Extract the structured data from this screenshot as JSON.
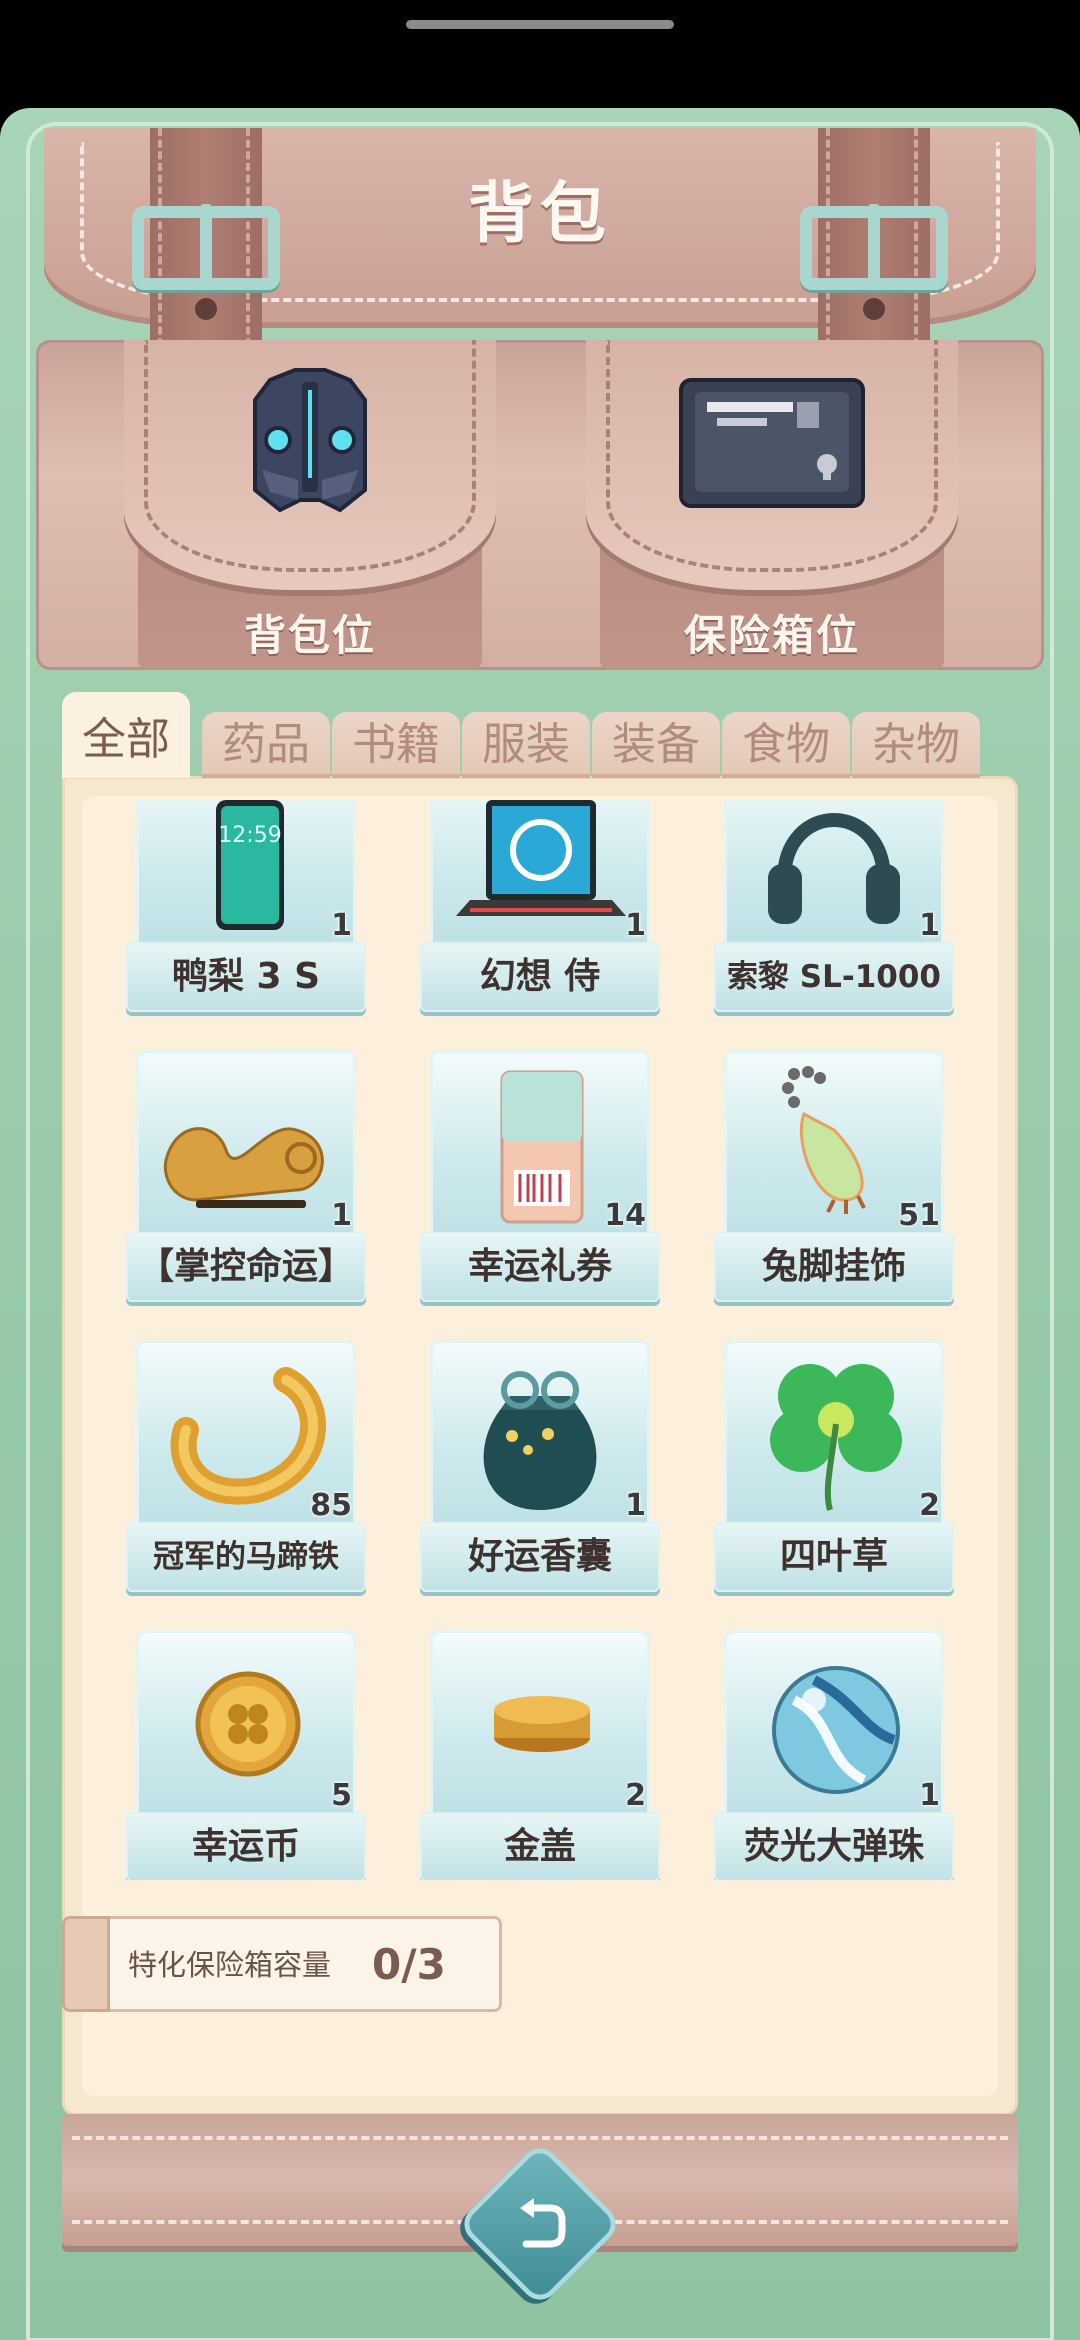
{
  "title": "背包",
  "pockets": [
    {
      "label": "背包位",
      "icon": "armor-vest-icon"
    },
    {
      "label": "保险箱位",
      "icon": "safe-box-icon"
    }
  ],
  "tabs": [
    "全部",
    "药品",
    "书籍",
    "服装",
    "装备",
    "食物",
    "杂物"
  ],
  "active_tab": "全部",
  "items": [
    {
      "name": "鸭梨 3 S",
      "count": "1",
      "icon": "smartphone-icon",
      "new": true
    },
    {
      "name": "幻想 侍",
      "count": "1",
      "icon": "laptop-icon",
      "new": true
    },
    {
      "name": "索黎 SL-1000",
      "count": "1",
      "icon": "headphones-icon",
      "new": true
    },
    {
      "name": "【掌控命运】",
      "count": "1",
      "icon": "ruyi-scepter-icon",
      "new": false
    },
    {
      "name": "幸运礼券",
      "count": "14",
      "icon": "coupon-ticket-icon",
      "new": false
    },
    {
      "name": "兔脚挂饰",
      "count": "51",
      "icon": "rabbit-foot-charm-icon",
      "new": false
    },
    {
      "name": "冠军的马蹄铁",
      "count": "85",
      "icon": "horseshoe-icon",
      "new": false
    },
    {
      "name": "好运香囊",
      "count": "1",
      "icon": "sachet-pouch-icon",
      "new": false
    },
    {
      "name": "四叶草",
      "count": "2",
      "icon": "four-leaf-clover-icon",
      "new": false
    },
    {
      "name": "幸运币",
      "count": "5",
      "icon": "lucky-coin-icon",
      "new": false
    },
    {
      "name": "金盖",
      "count": "2",
      "icon": "gold-cap-icon",
      "new": false
    },
    {
      "name": "荧光大弹珠",
      "count": "1",
      "icon": "marble-icon",
      "new": false
    }
  ],
  "capacity": {
    "label": "特化保险箱容量",
    "value": "0/3"
  },
  "colors": {
    "frame": "#98caa9",
    "leather": "#c99e93",
    "panel": "#fcf0dc",
    "card": "#cde9ec",
    "badge": "#e06a63"
  },
  "back_button_icon": "back-arrow-icon"
}
